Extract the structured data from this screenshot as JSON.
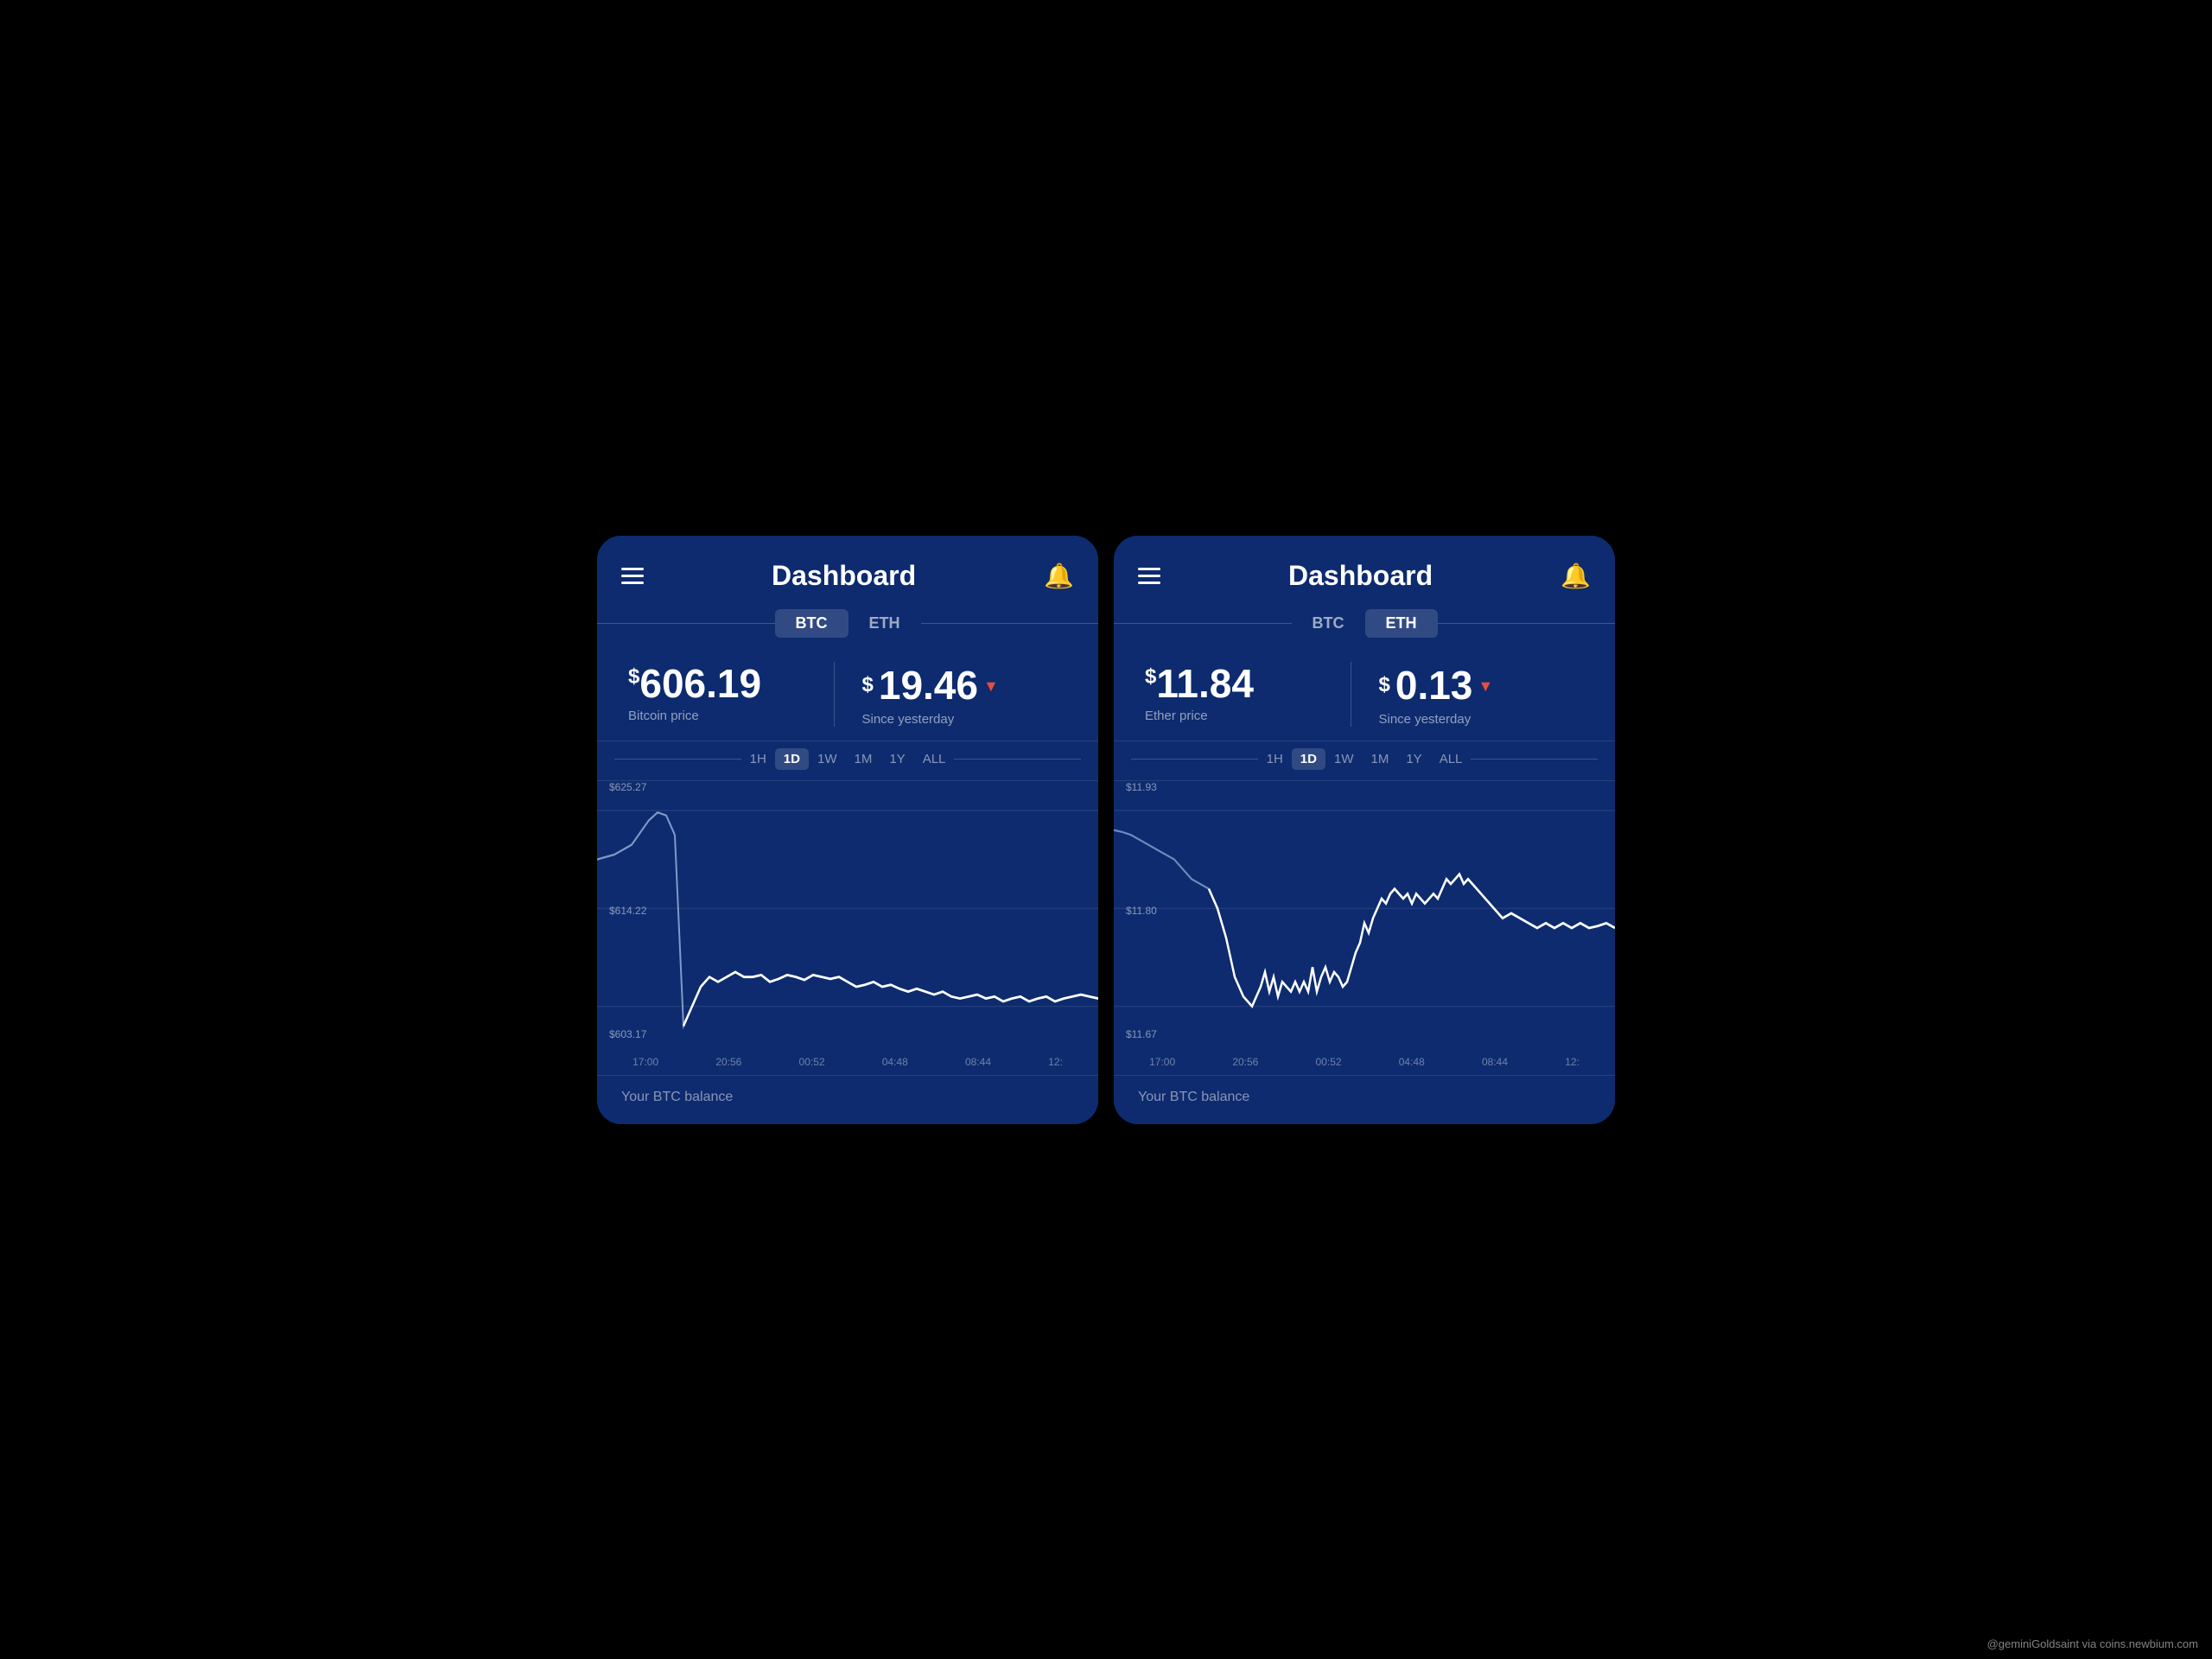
{
  "left": {
    "title": "Dashboard",
    "tabs": [
      "BTC",
      "ETH"
    ],
    "active_tab": "BTC",
    "price": {
      "main": "606.19",
      "label": "Bitcoin price",
      "change": "19.46",
      "change_label": "Since yesterday",
      "change_direction": "down"
    },
    "time_filters": [
      "1H",
      "1D",
      "1W",
      "1M",
      "1Y",
      "ALL"
    ],
    "active_filter": "1D",
    "chart": {
      "y_labels": [
        "$625.27",
        "$614.22",
        "$603.17"
      ],
      "x_labels": [
        "17:00",
        "20:56",
        "00:52",
        "04:48",
        "08:44",
        "12:"
      ]
    },
    "footer": "Your BTC balance"
  },
  "right": {
    "title": "Dashboard",
    "tabs": [
      "BTC",
      "ETH"
    ],
    "active_tab": "ETH",
    "price": {
      "main": "11.84",
      "label": "Ether price",
      "change": "0.13",
      "change_label": "Since yesterday",
      "change_direction": "down"
    },
    "time_filters": [
      "1H",
      "1D",
      "1W",
      "1M",
      "1Y",
      "ALL"
    ],
    "active_filter": "1D",
    "chart": {
      "y_labels": [
        "$11.93",
        "$11.80",
        "$11.67"
      ],
      "x_labels": [
        "17:00",
        "20:56",
        "00:52",
        "04:48",
        "08:44",
        "12:"
      ]
    },
    "footer": "Your BTC balance"
  },
  "attribution": "@geminiGoldsaint via coins.newbium.com"
}
